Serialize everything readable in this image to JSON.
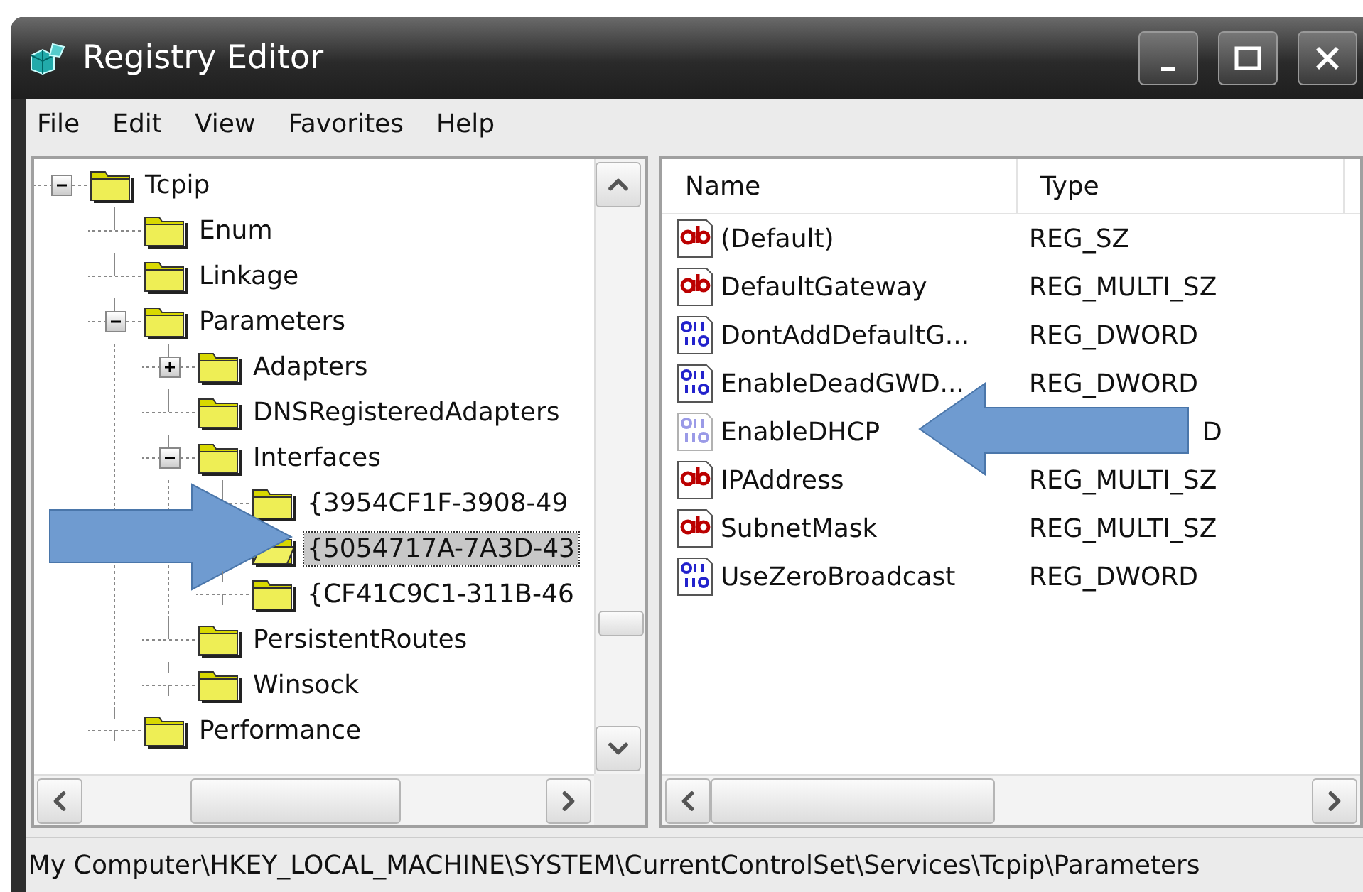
{
  "window": {
    "title": "Registry Editor"
  },
  "menu": [
    "File",
    "Edit",
    "View",
    "Favorites",
    "Help"
  ],
  "tree": [
    {
      "label": "Tcpip",
      "expanded": true,
      "selected": false,
      "pointed": false,
      "children": [
        {
          "label": "Enum",
          "selected": false,
          "pointed": false
        },
        {
          "label": "Linkage",
          "selected": false,
          "pointed": false
        },
        {
          "label": "Parameters",
          "expanded": true,
          "selected": false,
          "pointed": false,
          "children": [
            {
              "label": "Adapters",
              "expanded": false,
              "selected": false,
              "pointed": false
            },
            {
              "label": "DNSRegisteredAdapters",
              "selected": false,
              "pointed": false
            },
            {
              "label": "Interfaces",
              "expanded": true,
              "selected": false,
              "pointed": false,
              "children": [
                {
                  "label": "{3954CF1F-3908-49",
                  "selected": false,
                  "pointed": false
                },
                {
                  "label": "{5054717A-7A3D-43",
                  "selected": true,
                  "pointed": true
                },
                {
                  "label": "{CF41C9C1-311B-46",
                  "selected": false,
                  "pointed": false
                }
              ]
            },
            {
              "label": "PersistentRoutes",
              "selected": false,
              "pointed": false
            },
            {
              "label": "Winsock",
              "selected": false,
              "pointed": false
            }
          ]
        },
        {
          "label": "Performance",
          "selected": false,
          "pointed": false
        }
      ]
    }
  ],
  "list": {
    "columns": [
      "Name",
      "Type"
    ],
    "rows": [
      {
        "name": "(Default)",
        "type": "REG_SZ",
        "kind": "string",
        "dimmed": false,
        "pointed": false
      },
      {
        "name": "DefaultGateway",
        "type": "REG_MULTI_SZ",
        "kind": "string",
        "dimmed": false,
        "pointed": false
      },
      {
        "name": "DontAddDefaultG...",
        "type": "REG_DWORD",
        "kind": "binary",
        "dimmed": false,
        "pointed": false
      },
      {
        "name": "EnableDeadGWD...",
        "type": "REG_DWORD",
        "kind": "binary",
        "dimmed": false,
        "pointed": false
      },
      {
        "name": "EnableDHCP",
        "type": "D",
        "kind": "binary",
        "dimmed": true,
        "pointed": true
      },
      {
        "name": "IPAddress",
        "type": "REG_MULTI_SZ",
        "kind": "string",
        "dimmed": false,
        "pointed": false
      },
      {
        "name": "SubnetMask",
        "type": "REG_MULTI_SZ",
        "kind": "string",
        "dimmed": false,
        "pointed": false
      },
      {
        "name": "UseZeroBroadcast",
        "type": "REG_DWORD",
        "kind": "binary",
        "dimmed": false,
        "pointed": false
      }
    ]
  },
  "status_bar": "My Computer\\HKEY_LOCAL_MACHINE\\SYSTEM\\CurrentControlSet\\Services\\Tcpip\\Parameters"
}
